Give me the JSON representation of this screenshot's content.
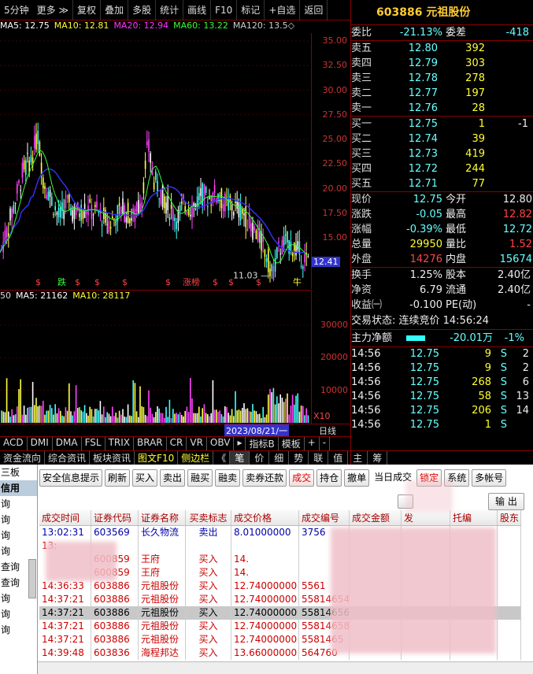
{
  "topbar": {
    "period": "5分钟",
    "more": "更多",
    "arrow": "≫",
    "buttons": [
      "复权",
      "叠加",
      "多股",
      "统计",
      "画线",
      "F10",
      "标记",
      "+自选",
      "返回"
    ]
  },
  "ma_legend": [
    {
      "text": "MA5: 12.75",
      "color": "#ffffff"
    },
    {
      "text": "MA10: 12.81",
      "color": "#ffff33"
    },
    {
      "text": "MA20: 12.94",
      "color": "#ff33ff"
    },
    {
      "text": "MA60: 13.22",
      "color": "#33ff33"
    },
    {
      "text": "MA120: 13.5◇",
      "color": "#cccccc"
    }
  ],
  "price_axis": {
    "ticks": [
      "35.00",
      "32.50",
      "30.00",
      "27.50",
      "25.00",
      "22.50",
      "20.00",
      "17.50",
      "15.00"
    ],
    "current": "12.41",
    "low_label": "11.03"
  },
  "event_marks": {
    "down": "跌",
    "limit_up": "涨榜",
    "bull": "牛",
    "small": "$"
  },
  "vol_legend": [
    {
      "text": "50",
      "color": "#dddddd"
    },
    {
      "text": "MA5: 21162",
      "color": "#ffffff"
    },
    {
      "text": "MA10: 28117",
      "color": "#ffff33"
    }
  ],
  "vol_axis": {
    "ticks": [
      "30000",
      "20000",
      "10000"
    ],
    "unit": "X10"
  },
  "time_axis": {
    "date": "2023/08/21/一",
    "right": "日线"
  },
  "ind_tabs": [
    "ACD",
    "DMI",
    "DMA",
    "FSL",
    "TRIX",
    "BRAR",
    "CR",
    "VR",
    "OBV",
    "▸",
    "指标B",
    "模板",
    "+",
    "-"
  ],
  "bottom_tabs": [
    "资金流向",
    "综合资讯",
    "板块资讯",
    "图文F10",
    "侧边栏",
    "《",
    "笔",
    "价",
    "细",
    "势",
    "联",
    "值",
    "主",
    "筹"
  ],
  "quote": {
    "code": "603886",
    "name": "元祖股份",
    "weibi_label": "委比",
    "weibi": "-21.13%",
    "weicha_label": "委差",
    "weicha": "-418",
    "asks": [
      {
        "label": "卖五",
        "price": "12.80",
        "vol": "392"
      },
      {
        "label": "卖四",
        "price": "12.79",
        "vol": "303"
      },
      {
        "label": "卖三",
        "price": "12.78",
        "vol": "278"
      },
      {
        "label": "卖二",
        "price": "12.77",
        "vol": "197"
      },
      {
        "label": "卖一",
        "price": "12.76",
        "vol": "28"
      }
    ],
    "bids": [
      {
        "label": "买一",
        "price": "12.75",
        "vol": "1",
        "chg": "-1"
      },
      {
        "label": "买二",
        "price": "12.74",
        "vol": "39",
        "chg": ""
      },
      {
        "label": "买三",
        "price": "12.73",
        "vol": "419",
        "chg": ""
      },
      {
        "label": "买四",
        "price": "12.72",
        "vol": "244",
        "chg": ""
      },
      {
        "label": "买五",
        "price": "12.71",
        "vol": "77",
        "chg": ""
      }
    ],
    "stats": [
      {
        "l1": "现价",
        "v1": "12.75",
        "l2": "今开",
        "v2": "12.80",
        "c1": "cyan",
        "c2": "white"
      },
      {
        "l1": "涨跌",
        "v1": "-0.05",
        "l2": "最高",
        "v2": "12.82",
        "c1": "cyan",
        "c2": "red"
      },
      {
        "l1": "涨幅",
        "v1": "-0.39%",
        "l2": "最低",
        "v2": "12.72",
        "c1": "cyan",
        "c2": "cyan"
      },
      {
        "l1": "总量",
        "v1": "29950",
        "l2": "量比",
        "v2": "1.52",
        "c1": "yellow",
        "c2": "red"
      },
      {
        "l1": "外盘",
        "v1": "14276",
        "l2": "内盘",
        "v2": "15674",
        "c1": "red",
        "c2": "cyan"
      }
    ],
    "stats2": [
      {
        "l1": "换手",
        "v1": "1.25%",
        "l2": "股本",
        "v2": "2.40亿"
      },
      {
        "l1": "净资",
        "v1": "6.79",
        "l2": "流通",
        "v2": "2.40亿"
      },
      {
        "l1": "收益㈠",
        "v1": "-0.100",
        "l2": "PE(动)",
        "v2": "-"
      }
    ],
    "trade_status": "交易状态: 连续竞价 14:56:24",
    "main_flow_label": "主力净额",
    "main_flow": "-20.01万",
    "main_flow_pct": "-1%",
    "ticks": [
      {
        "t": "14:56",
        "p": "12.75",
        "v": "9",
        "d": "S",
        "n": "2"
      },
      {
        "t": "14:56",
        "p": "12.75",
        "v": "9",
        "d": "S",
        "n": "2"
      },
      {
        "t": "14:56",
        "p": "12.75",
        "v": "268",
        "d": "S",
        "n": "6"
      },
      {
        "t": "14:56",
        "p": "12.75",
        "v": "58",
        "d": "S",
        "n": "13"
      },
      {
        "t": "14:56",
        "p": "12.75",
        "v": "206",
        "d": "S",
        "n": "14"
      },
      {
        "t": "14:56",
        "p": "12.75",
        "v": "1",
        "d": "S",
        "n": ""
      }
    ]
  },
  "trade": {
    "tree": [
      "三板",
      "信用",
      "询",
      "询",
      "询",
      "询",
      "查询",
      "查询",
      "询",
      "询",
      "询"
    ],
    "buttons": [
      "安全信息提示",
      "刷新",
      "买入",
      "卖出",
      "融买",
      "融卖",
      "卖券还款",
      "成交",
      "持仓",
      "撤单",
      "当日成交",
      "锁定",
      "系统",
      "多帐号"
    ],
    "export": "输 出",
    "headers": [
      "成交时间",
      "证券代码",
      "证券名称",
      "买卖标志",
      "成交价格",
      "成交编号",
      "成交金额",
      "发",
      "托编",
      "股东"
    ],
    "rows": [
      {
        "time": "13:02:31",
        "code": "603569",
        "name": "长久物流",
        "side": "卖出",
        "price": "8.01000000",
        "no": "3756",
        "style": "blue"
      },
      {
        "time": "13:",
        "code": "",
        "name": "",
        "side": "",
        "price": "",
        "no": "",
        "style": ""
      },
      {
        "time": "",
        "code": "600859",
        "name": "王府",
        "side": "买入",
        "price": "14.",
        "no": "",
        "style": ""
      },
      {
        "time": "",
        "code": "600859",
        "name": "王府",
        "side": "买入",
        "price": "14.",
        "no": "",
        "style": ""
      },
      {
        "time": "14:36:33",
        "code": "603886",
        "name": "元祖股份",
        "side": "买入",
        "price": "12.74000000",
        "no": "5561",
        "style": ""
      },
      {
        "time": "14:37:21",
        "code": "603886",
        "name": "元祖股份",
        "side": "买入",
        "price": "12.74000000",
        "no": "55814654",
        "style": ""
      },
      {
        "time": "14:37:21",
        "code": "603886",
        "name": "元祖股份",
        "side": "买入",
        "price": "12.74000000",
        "no": "55814656",
        "style": "sel"
      },
      {
        "time": "14:37:21",
        "code": "603886",
        "name": "元祖股份",
        "side": "买入",
        "price": "12.74000000",
        "no": "55814658",
        "style": ""
      },
      {
        "time": "14:37:21",
        "code": "603886",
        "name": "元祖股份",
        "side": "买入",
        "price": "12.74000000",
        "no": "5581465",
        "style": ""
      },
      {
        "time": "14:39:48",
        "code": "603836",
        "name": "海程邦达",
        "side": "买入",
        "price": "13.66000000",
        "no": "564760",
        "style": ""
      }
    ]
  }
}
